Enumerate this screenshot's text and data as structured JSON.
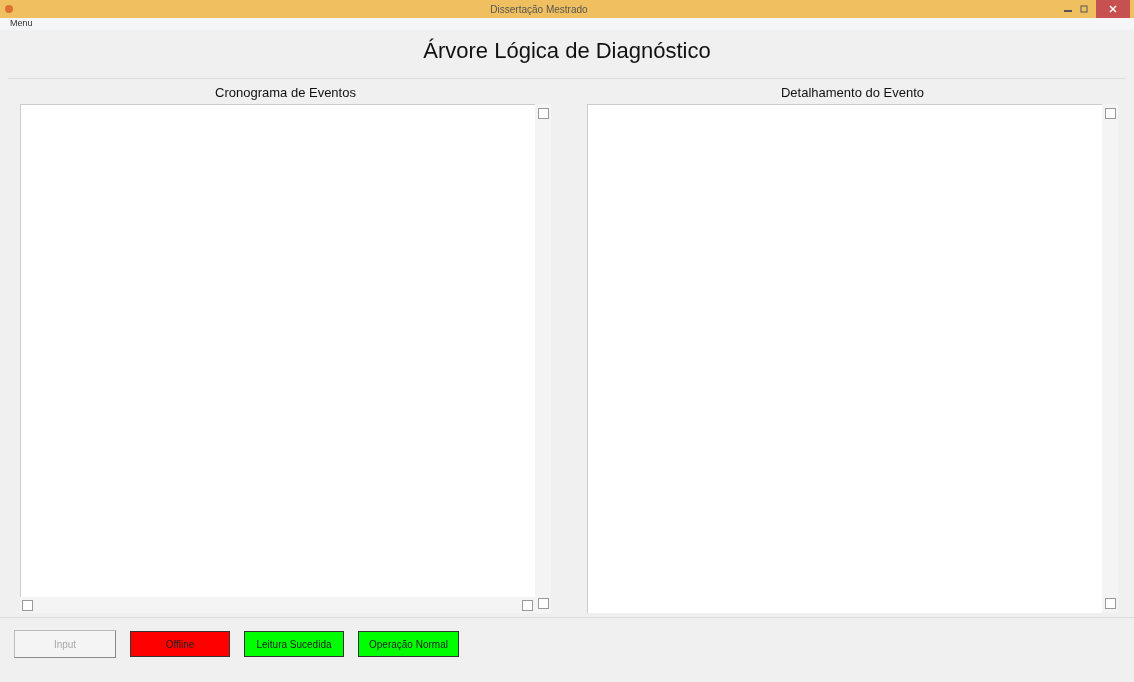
{
  "window": {
    "title": "Dissertação Mestrado"
  },
  "menu": [
    "Menu"
  ],
  "heading": "Árvore Lógica de Diagnóstico",
  "panels": [
    {
      "title": "Cronograma de Eventos",
      "horizontal_scroll": true
    },
    {
      "title": "Detalhamento do Evento",
      "horizontal_scroll": false
    }
  ],
  "input_button": {
    "label": "Input",
    "disabled": true
  },
  "indicators": [
    {
      "label": "Offline",
      "color": "#ff0000"
    },
    {
      "label": "Leitura Sucedida",
      "color": "#00ff00"
    },
    {
      "label": "Operação Normal",
      "color": "#00ff00"
    }
  ]
}
